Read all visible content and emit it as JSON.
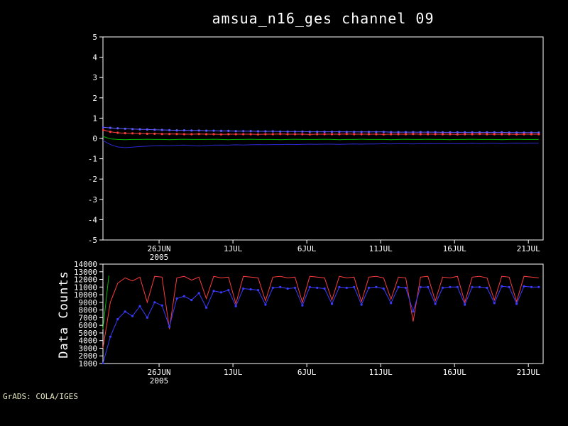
{
  "title": "amsua_n16_ges channel 09",
  "credit": "GrADS: COLA/IGES",
  "colors": {
    "background": "#000000",
    "frame": "#ffffff",
    "text": "#ffffff",
    "credit_text": "#e8e8c0",
    "red": "#fa3c3c",
    "blue_marker": "#5a5aff",
    "blue_line": "#2828d2",
    "blue_counts": "#3a3aff",
    "green": "#00b400"
  },
  "chart_data": [
    {
      "type": "line",
      "title": "amsua_n16_ges channel 09",
      "xlabel": "",
      "ylabel": "",
      "ylim": [
        -5,
        5
      ],
      "yticks": [
        5,
        4,
        3,
        2,
        1,
        0,
        -1,
        -2,
        -3,
        -4,
        -5
      ],
      "xlim": [
        0,
        29.8
      ],
      "x_start": 0,
      "x_step": 0.5,
      "grid": false,
      "legend": "none",
      "xticks": [
        {
          "pos": 3.8,
          "label": "26JUN",
          "sub": "2005"
        },
        {
          "pos": 8.8,
          "label": "1JUL"
        },
        {
          "pos": 13.8,
          "label": "6JUL"
        },
        {
          "pos": 18.8,
          "label": "11JUL"
        },
        {
          "pos": 23.8,
          "label": "16JUL"
        },
        {
          "pos": 28.8,
          "label": "21JUL"
        }
      ],
      "series": [
        {
          "name": "blue-marker-bias",
          "color": "#5a5aff",
          "marker": true,
          "values": [
            0.55,
            0.52,
            0.5,
            0.48,
            0.46,
            0.45,
            0.44,
            0.43,
            0.42,
            0.41,
            0.4,
            0.4,
            0.39,
            0.39,
            0.38,
            0.38,
            0.37,
            0.37,
            0.36,
            0.36,
            0.36,
            0.35,
            0.35,
            0.35,
            0.34,
            0.34,
            0.34,
            0.34,
            0.33,
            0.33,
            0.33,
            0.33,
            0.33,
            0.32,
            0.32,
            0.32,
            0.32,
            0.32,
            0.32,
            0.31,
            0.31,
            0.31,
            0.31,
            0.31,
            0.31,
            0.31,
            0.3,
            0.3,
            0.3,
            0.3,
            0.3,
            0.3,
            0.3,
            0.3,
            0.3,
            0.29,
            0.29,
            0.29,
            0.29,
            0.29
          ]
        },
        {
          "name": "red-marker-bias",
          "color": "#fa3c3c",
          "marker": true,
          "values": [
            0.42,
            0.33,
            0.28,
            0.26,
            0.25,
            0.24,
            0.23,
            0.23,
            0.22,
            0.22,
            0.22,
            0.21,
            0.21,
            0.22,
            0.21,
            0.21,
            0.2,
            0.21,
            0.21,
            0.21,
            0.21,
            0.2,
            0.21,
            0.21,
            0.22,
            0.21,
            0.21,
            0.21,
            0.2,
            0.21,
            0.21,
            0.21,
            0.21,
            0.22,
            0.21,
            0.21,
            0.21,
            0.21,
            0.2,
            0.21,
            0.21,
            0.21,
            0.22,
            0.21,
            0.21,
            0.21,
            0.21,
            0.21,
            0.2,
            0.21,
            0.21,
            0.22,
            0.21,
            0.21,
            0.21,
            0.21,
            0.2,
            0.21,
            0.21,
            0.21
          ]
        },
        {
          "name": "green-bias",
          "color": "#00b400",
          "marker": false,
          "values": [
            0.1,
            -0.02,
            -0.05,
            -0.06,
            -0.05,
            -0.05,
            -0.04,
            -0.05,
            -0.05,
            -0.06,
            -0.05,
            -0.04,
            -0.05,
            -0.05,
            -0.05,
            -0.04,
            -0.05,
            -0.06,
            -0.05,
            -0.05,
            -0.04,
            -0.05,
            -0.05,
            -0.05,
            -0.06,
            -0.05,
            -0.04,
            -0.05,
            -0.05,
            -0.05,
            -0.04,
            -0.05,
            -0.06,
            -0.05,
            -0.05,
            -0.04,
            -0.05,
            -0.05,
            -0.05,
            -0.06,
            -0.05,
            -0.04,
            -0.05,
            -0.05,
            -0.04,
            -0.05,
            -0.05,
            -0.06,
            -0.05,
            -0.05,
            -0.04,
            -0.05,
            -0.05,
            -0.05,
            -0.06,
            -0.05,
            -0.04,
            -0.05,
            -0.05,
            -0.05
          ]
        },
        {
          "name": "blue-line-bias",
          "color": "#2828d2",
          "marker": false,
          "values": [
            -0.1,
            -0.3,
            -0.42,
            -0.45,
            -0.43,
            -0.4,
            -0.38,
            -0.36,
            -0.35,
            -0.36,
            -0.34,
            -0.33,
            -0.35,
            -0.37,
            -0.35,
            -0.33,
            -0.32,
            -0.33,
            -0.31,
            -0.32,
            -0.31,
            -0.3,
            -0.31,
            -0.3,
            -0.3,
            -0.29,
            -0.3,
            -0.29,
            -0.28,
            -0.29,
            -0.28,
            -0.28,
            -0.29,
            -0.28,
            -0.27,
            -0.28,
            -0.27,
            -0.27,
            -0.26,
            -0.27,
            -0.26,
            -0.26,
            -0.27,
            -0.26,
            -0.25,
            -0.26,
            -0.25,
            -0.25,
            -0.26,
            -0.25,
            -0.24,
            -0.25,
            -0.24,
            -0.24,
            -0.25,
            -0.24,
            -0.23,
            -0.24,
            -0.23,
            -0.23
          ]
        }
      ]
    },
    {
      "type": "line",
      "title": "",
      "xlabel": "",
      "ylabel": "Data Counts",
      "ylim": [
        1000,
        14000
      ],
      "yticks": [
        14000,
        13000,
        12000,
        11000,
        10000,
        9000,
        8000,
        7000,
        6000,
        5000,
        4000,
        3000,
        2000,
        1000
      ],
      "xlim": [
        0,
        29.8
      ],
      "x_start": 0,
      "x_step": 0.5,
      "grid": false,
      "legend": "none",
      "xticks": [
        {
          "pos": 3.8,
          "label": "26JUN",
          "sub": "2005"
        },
        {
          "pos": 8.8,
          "label": "1JUL"
        },
        {
          "pos": 13.8,
          "label": "6JUL"
        },
        {
          "pos": 18.8,
          "label": "11JUL"
        },
        {
          "pos": 23.8,
          "label": "16JUL"
        },
        {
          "pos": 28.8,
          "label": "21JUL"
        }
      ],
      "series": [
        {
          "name": "red-counts",
          "color": "#fa3c3c",
          "marker": false,
          "values": [
            3000,
            9000,
            11500,
            12200,
            11800,
            12300,
            9000,
            12400,
            12300,
            5500,
            12200,
            12400,
            11900,
            12300,
            9500,
            12400,
            12200,
            12300,
            8800,
            12400,
            12300,
            12200,
            9200,
            12300,
            12400,
            12200,
            12300,
            9000,
            12400,
            12300,
            12200,
            9300,
            12400,
            12200,
            12300,
            9100,
            12300,
            12400,
            12200,
            9400,
            12300,
            12200,
            6500,
            12300,
            12400,
            9200,
            12300,
            12200,
            12400,
            9000,
            12300,
            12400,
            12200,
            9300,
            12400,
            12300,
            9100,
            12400,
            12300,
            12200
          ]
        },
        {
          "name": "blue-counts",
          "color": "#3a3aff",
          "marker": true,
          "values": [
            1000,
            4500,
            6800,
            7800,
            7200,
            8500,
            7000,
            9000,
            8600,
            5800,
            9500,
            9800,
            9300,
            10200,
            8300,
            10500,
            10300,
            10600,
            8500,
            10800,
            10700,
            10600,
            8700,
            10900,
            11000,
            10800,
            10900,
            8600,
            11000,
            10900,
            10800,
            8800,
            11000,
            10900,
            11000,
            8700,
            10900,
            11000,
            10800,
            8900,
            11000,
            10900,
            7800,
            11000,
            11000,
            8800,
            10900,
            11000,
            11000,
            8700,
            11000,
            11000,
            10900,
            8900,
            11100,
            11000,
            8800,
            11100,
            11000,
            11000
          ]
        },
        {
          "name": "green-counts-spike",
          "color": "#00b400",
          "marker": false,
          "x": [
            0,
            0.4
          ],
          "values": [
            5500,
            12500
          ]
        }
      ]
    }
  ]
}
